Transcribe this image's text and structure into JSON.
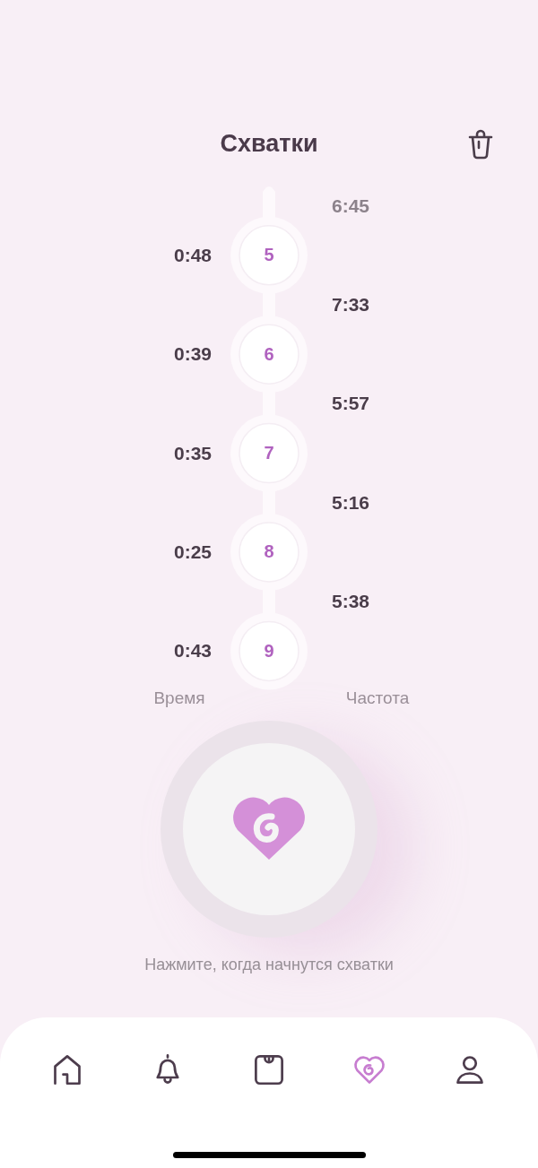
{
  "header": {
    "title": "Схватки"
  },
  "timeline": {
    "items": [
      {
        "kind": "interval",
        "text": "6:45",
        "faded": true
      },
      {
        "kind": "contraction",
        "number": "5",
        "duration": "0:48"
      },
      {
        "kind": "interval",
        "text": "7:33",
        "faded": false
      },
      {
        "kind": "contraction",
        "number": "6",
        "duration": "0:39"
      },
      {
        "kind": "interval",
        "text": "5:57",
        "faded": false
      },
      {
        "kind": "contraction",
        "number": "7",
        "duration": "0:35"
      },
      {
        "kind": "interval",
        "text": "5:16",
        "faded": false
      },
      {
        "kind": "contraction",
        "number": "8",
        "duration": "0:25"
      },
      {
        "kind": "interval",
        "text": "5:38",
        "faded": false
      },
      {
        "kind": "contraction",
        "number": "9",
        "duration": "0:43"
      }
    ]
  },
  "column_labels": [
    "Время",
    "Частота"
  ],
  "record_button": {
    "hint": "Нажмите, когда начнутся схватки"
  },
  "tab_bar": {
    "tabs": [
      {
        "kind": "home",
        "selected": false
      },
      {
        "kind": "bell",
        "selected": false
      },
      {
        "kind": "scale",
        "selected": false
      },
      {
        "kind": "contractions",
        "selected": true
      },
      {
        "kind": "profile",
        "selected": false
      }
    ]
  }
}
